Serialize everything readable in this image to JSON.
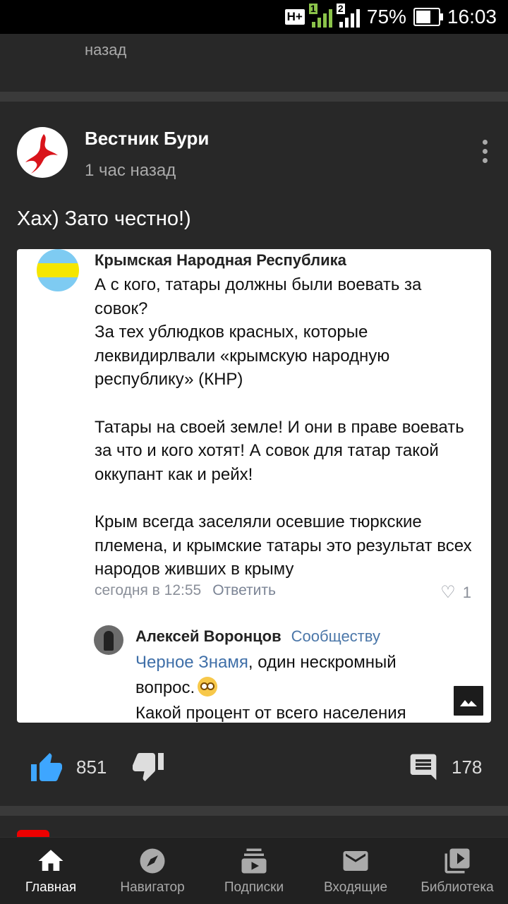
{
  "status_bar": {
    "network": "H+",
    "sim1": "1",
    "sim2": "2",
    "battery": "75%",
    "battery_level": 0.75,
    "time": "16:03"
  },
  "previous_card": {
    "time": "назад"
  },
  "post": {
    "channel_name": "Вестник Бури",
    "time": "1 час назад",
    "text": "Хах) Зато честно!)",
    "image": {
      "author": "Крымская Народная Республика",
      "paragraphs": [
        "А с кого, татары должны были воевать за совок?",
        "За тех ублюдков красных, которые леквидирлвали «крымскую народную республику» (КНР)",
        "Татары на своей земле! И они в праве воевать за что и кого хотят! А совок для татар такой оккупант как и рейх!",
        "Крым всегда заселяли осевшие тюркские племена, и крымские татары это результат всех народов живших в крыму"
      ],
      "comment_time": "сегодня в 12:55",
      "reply_label": "Ответить",
      "likes": "1",
      "reply": {
        "author": "Алексей Воронцов",
        "to": "Сообществу",
        "link": "Черное Знамя",
        "text_after_link": ", один нескромный вопрос.",
        "line2": "Какой процент от всего населения"
      }
    },
    "likes": "851",
    "comments": "178"
  },
  "icons": {
    "like": "thumb-up-icon",
    "dislike": "thumb-down-icon",
    "comments": "comment-icon",
    "more": "more-vert-icon",
    "image": "image-icon"
  },
  "colors": {
    "accent": "#3ea6ff",
    "background": "#1c1c1c",
    "card": "#282828"
  },
  "bottom_nav": {
    "items": [
      {
        "label": "Главная",
        "icon": "home-icon",
        "active": true
      },
      {
        "label": "Навигатор",
        "icon": "compass-icon",
        "active": false
      },
      {
        "label": "Подписки",
        "icon": "subscriptions-icon",
        "active": false
      },
      {
        "label": "Входящие",
        "icon": "mail-icon",
        "active": false
      },
      {
        "label": "Библиотека",
        "icon": "library-icon",
        "active": false
      }
    ]
  }
}
